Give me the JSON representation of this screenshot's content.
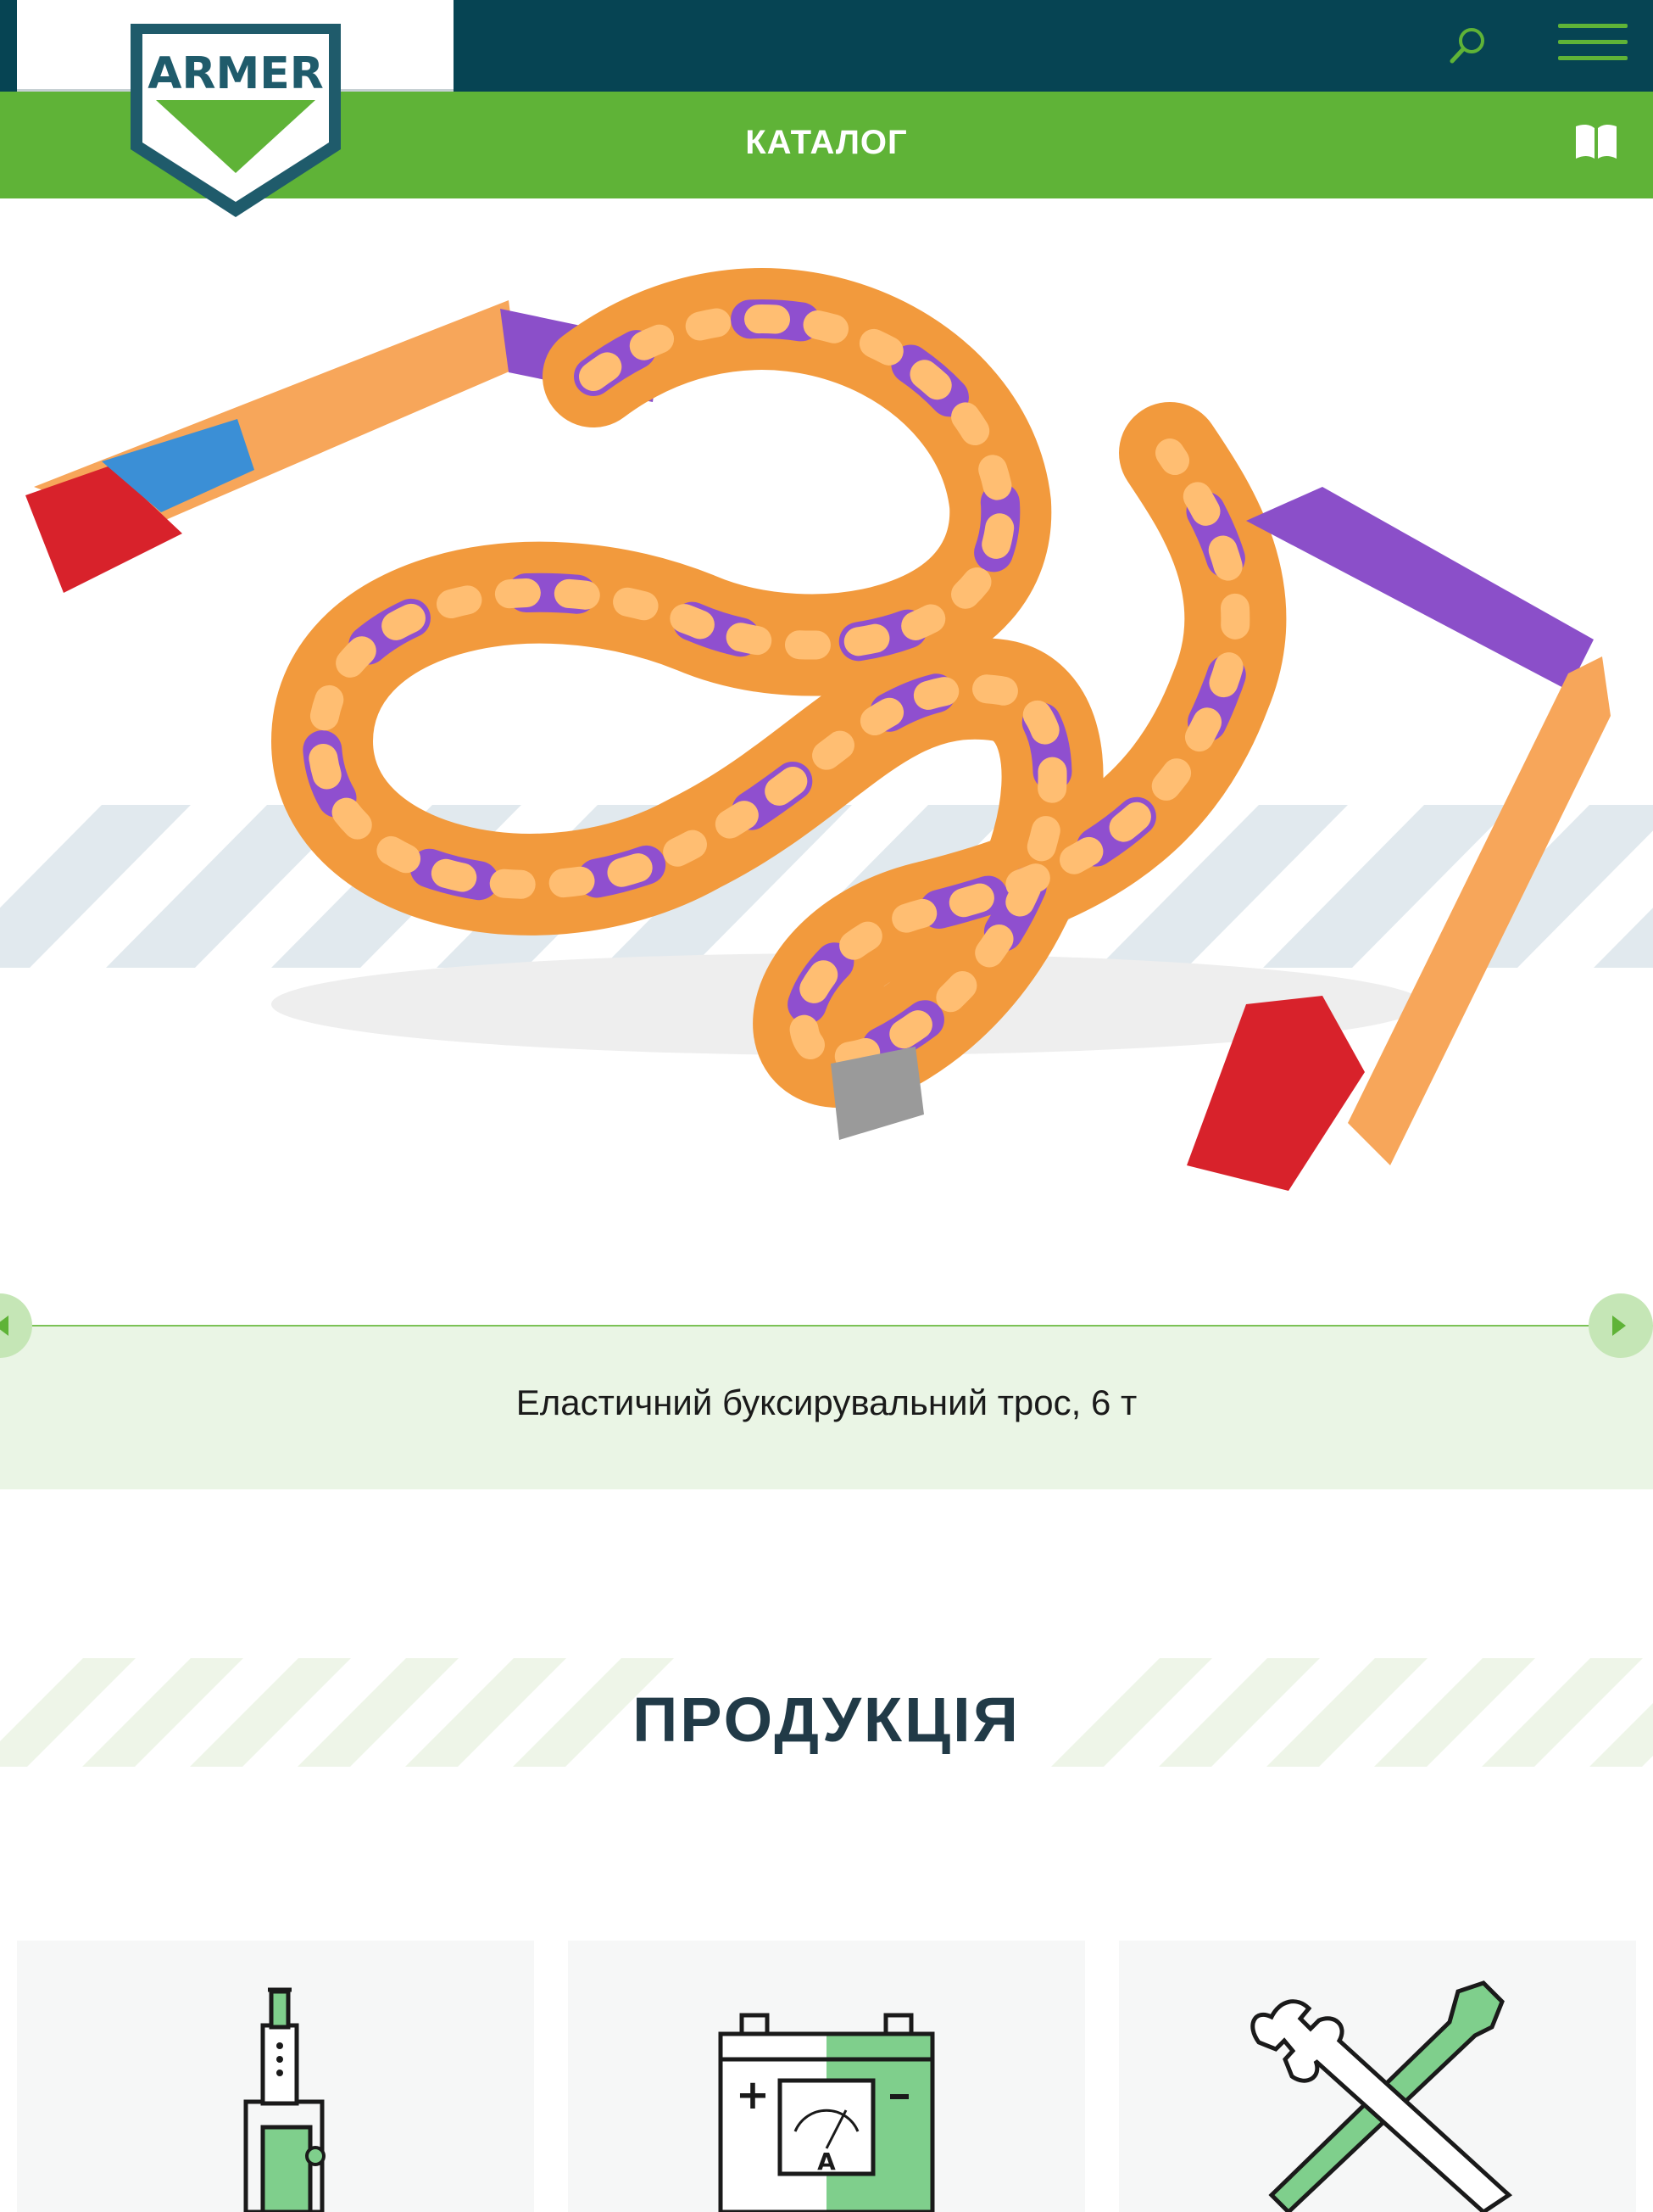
{
  "header": {
    "logo_text": "ARMER",
    "catalog_label": "КАТАЛОГ",
    "search_icon": "search-icon",
    "menu_icon": "hamburger-menu-icon",
    "catalog_icon": "book-icon"
  },
  "slider": {
    "caption": "Еластичний буксирувальний трос, 6 т",
    "prev_icon": "arrow-left-icon",
    "next_icon": "arrow-right-icon"
  },
  "products": {
    "title": "ПРОДУКЦІЯ",
    "categories": [
      {
        "icon": "hydraulic-jack-icon"
      },
      {
        "icon": "car-battery-icon"
      },
      {
        "icon": "wrench-screwdriver-icon"
      }
    ]
  },
  "colors": {
    "brand_green": "#5fb337",
    "dark_teal": "#064453",
    "title_navy": "#213a47",
    "caption_bg": "#eaf5e5"
  }
}
